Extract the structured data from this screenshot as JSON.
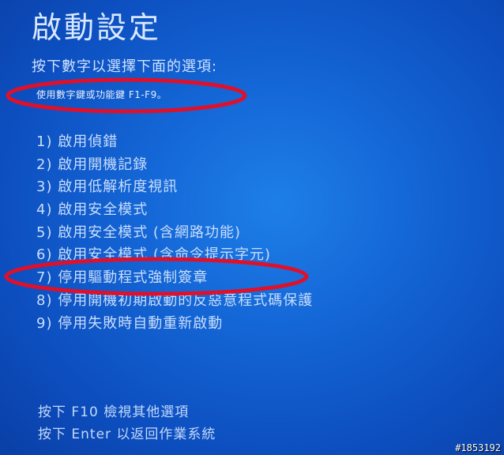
{
  "title": "啟動設定",
  "subtitle": "按下數字以選擇下面的選項:",
  "hint": "使用數字鍵或功能鍵 F1-F9。",
  "options": [
    {
      "label": "1) 啟用偵錯"
    },
    {
      "label": "2) 啟用開機記錄"
    },
    {
      "label": "3) 啟用低解析度視訊"
    },
    {
      "label": "4) 啟用安全模式"
    },
    {
      "label": "5) 啟用安全模式 (含網路功能)"
    },
    {
      "label": "6) 啟用安全模式 (含命令提示字元)"
    },
    {
      "label": "7) 停用驅動程式強制簽章"
    },
    {
      "label": "8) 停用開機初期啟動的反惡意程式碼保護"
    },
    {
      "label": "9) 停用失敗時自動重新啟動"
    }
  ],
  "footer": {
    "more_options": "按下 F10 檢視其他選項",
    "return": "按下 Enter 以返回作業系統"
  },
  "watermark": "#1853192",
  "colors": {
    "background": "#1466d6",
    "text": "#cfe3ff",
    "annotation": "#e0102a"
  }
}
